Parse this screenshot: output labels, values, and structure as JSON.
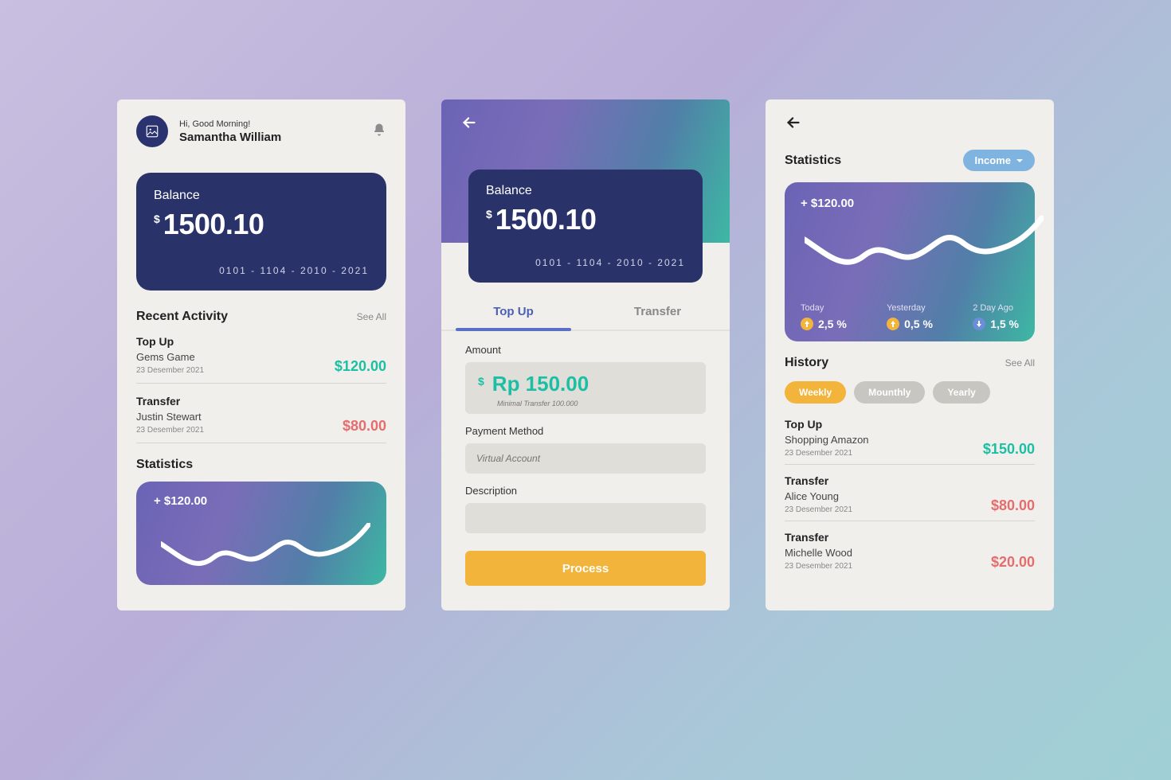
{
  "colors": {
    "navy": "#2a326a",
    "teal": "#1bbfa3",
    "red": "#e46d6d",
    "amber": "#f2b43a"
  },
  "screen1": {
    "greeting": "Hi, Good Morning!",
    "user_name": "Samantha William",
    "balance": {
      "label": "Balance",
      "currency": "$",
      "amount": "1500.10",
      "card_number": "0101 - 1104 - 2010 - 2021"
    },
    "recent": {
      "title": "Recent Activity",
      "see_all": "See All",
      "items": [
        {
          "title": "Top Up",
          "sub": "Gems Game",
          "date": "23 Desember 2021",
          "amount": "$120.00",
          "positive": true
        },
        {
          "title": "Transfer",
          "sub": "Justin Stewart",
          "date": "23 Desember 2021",
          "amount": "$80.00",
          "positive": false
        }
      ]
    },
    "stats_title": "Statistics",
    "stats_delta": "+ $120.00"
  },
  "screen2": {
    "balance": {
      "label": "Balance",
      "currency": "$",
      "amount": "1500.10",
      "card_number": "0101 - 1104 - 2010 - 2021"
    },
    "tabs": {
      "topup": "Top Up",
      "transfer": "Transfer"
    },
    "form": {
      "amount_label": "Amount",
      "amount_currency": "$",
      "amount_value": "Rp 150.00",
      "min_note": "Minimal Transfer 100.000",
      "method_label": "Payment Method",
      "method_placeholder": "Virtual Account",
      "desc_label": "Description",
      "process": "Process"
    }
  },
  "screen3": {
    "title": "Statistics",
    "filter": "Income",
    "delta": "+ $120.00",
    "cols": [
      {
        "label": "Today",
        "value": "2,5 %",
        "dir": "up"
      },
      {
        "label": "Yesterday",
        "value": "0,5 %",
        "dir": "up"
      },
      {
        "label": "2 Day Ago",
        "value": "1,5 %",
        "dir": "down"
      }
    ],
    "history": {
      "title": "History",
      "see_all": "See All",
      "chips": [
        "Weekly",
        "Mounthly",
        "Yearly"
      ],
      "items": [
        {
          "title": "Top Up",
          "sub": "Shopping Amazon",
          "date": "23 Desember 2021",
          "amount": "$150.00",
          "positive": true
        },
        {
          "title": "Transfer",
          "sub": "Alice Young",
          "date": "23 Desember 2021",
          "amount": "$80.00",
          "positive": false
        },
        {
          "title": "Transfer",
          "sub": "Michelle Wood",
          "date": "23 Desember 2021",
          "amount": "$20.00",
          "positive": false
        }
      ]
    }
  },
  "chart_data": {
    "type": "line",
    "title": "",
    "series": [
      {
        "name": "balance-trend",
        "values": [
          60,
          52,
          30,
          55,
          35,
          58,
          48,
          46,
          55,
          95
        ]
      }
    ],
    "x": [
      0,
      1,
      2,
      3,
      4,
      5,
      6,
      7,
      8,
      9
    ],
    "ylim": [
      0,
      100
    ]
  }
}
